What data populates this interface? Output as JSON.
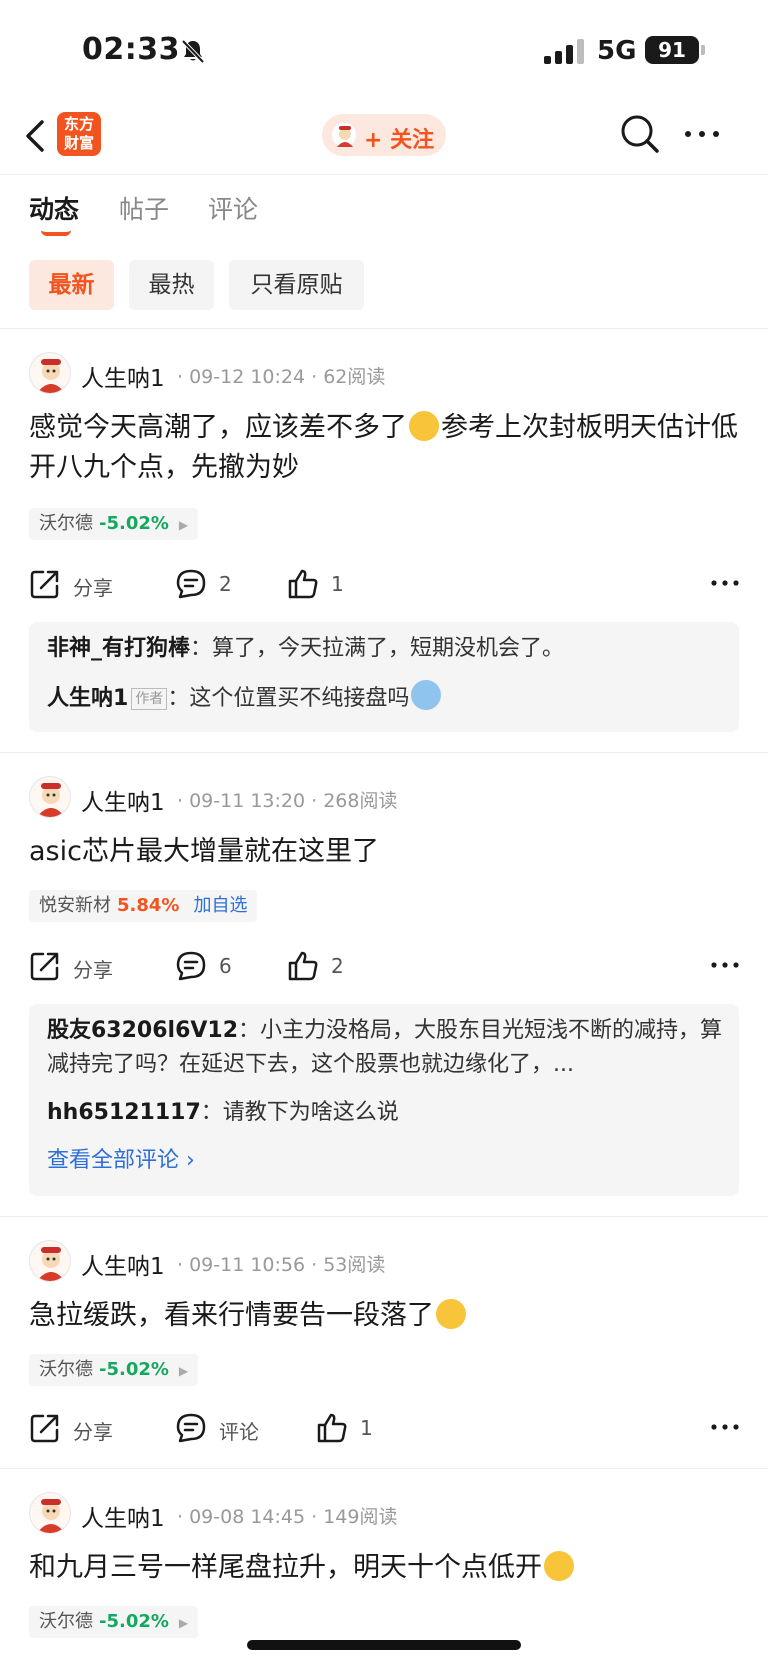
{
  "status_bar": {
    "time": "02:33",
    "network": "5G",
    "battery": "91"
  },
  "nav": {
    "logo_line1": "东方",
    "logo_line2": "财富",
    "follow_label": "+ 关注"
  },
  "tabs": [
    {
      "label": "动态"
    },
    {
      "label": "帖子"
    },
    {
      "label": "评论"
    }
  ],
  "filters": [
    {
      "label": "最新"
    },
    {
      "label": "最热"
    },
    {
      "label": "只看原贴"
    }
  ],
  "posts": [
    {
      "author": "人生呐1",
      "meta": "· 09-12 10:24 · 62阅读",
      "text_a": "感觉今天高潮了，应该差不多了",
      "text_b": "参考上次封板明天估计低开八九个点，先撤为妙",
      "stock": {
        "name": "沃尔德",
        "change": "-5.02%"
      },
      "share": "分享",
      "comments_count": "2",
      "likes": "1",
      "comments": [
        {
          "user": "非神_有打狗棒",
          "text": "：算了，今天拉满了，短期没机会了。"
        },
        {
          "user": "人生呐1",
          "badge": "作者",
          "text": "：这个位置买不纯接盘吗"
        }
      ]
    },
    {
      "author": "人生呐1",
      "meta": "· 09-11 13:20 · 268阅读",
      "text": "asic芯片最大增量就在这里了",
      "stock": {
        "name": "悦安新材",
        "change": "5.84%",
        "add": "加自选"
      },
      "share": "分享",
      "comments_count": "6",
      "likes": "2",
      "comments": [
        {
          "user": "股友63206l6V12",
          "text": "：小主力没格局，大股东目光短浅不断的减持，算减持完了吗？在延迟下去，这个股票也就边缘化了，..."
        },
        {
          "user": "hh65121117",
          "text": "：请教下为啥这么说"
        }
      ],
      "view_all": "查看全部评论 ›"
    },
    {
      "author": "人生呐1",
      "meta": "· 09-11 10:56 · 53阅读",
      "text": "急拉缓跌，看来行情要告一段落了",
      "stock": {
        "name": "沃尔德",
        "change": "-5.02%"
      },
      "share": "分享",
      "comments_label": "评论",
      "likes": "1"
    },
    {
      "author": "人生呐1",
      "meta": "· 09-08 14:45 · 149阅读",
      "text": "和九月三号一样尾盘拉升，明天十个点低开",
      "stock": {
        "name": "沃尔德",
        "change": "-5.02%"
      }
    }
  ],
  "colors": {
    "accent": "#f1541f",
    "down": "#15a85f",
    "link": "#2f6fd6"
  }
}
